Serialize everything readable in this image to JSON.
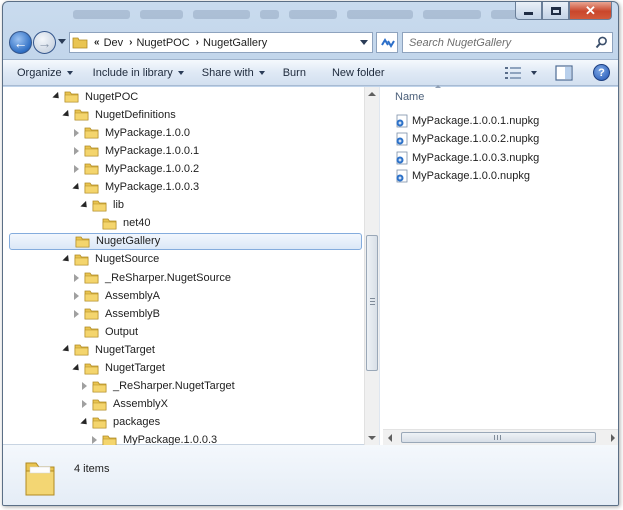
{
  "window": {
    "title_bar": {
      "minimize": "minimize",
      "maximize": "maximize",
      "close": "close"
    }
  },
  "nav": {
    "breadcrumb_prefix": "«",
    "breadcrumbs": [
      "Dev",
      "NugetPOC",
      "NugetGallery"
    ],
    "search_placeholder": "Search NugetGallery"
  },
  "toolbar": {
    "organize": "Organize",
    "include_in_library": "Include in library",
    "share_with": "Share with",
    "burn": "Burn",
    "new_folder": "New folder",
    "help": "?"
  },
  "tree": {
    "items": [
      {
        "label": "NugetPOC",
        "level": 0,
        "state": "expanded"
      },
      {
        "label": "NugetDefinitions",
        "level": 1,
        "state": "expanded"
      },
      {
        "label": "MyPackage.1.0.0",
        "level": 2,
        "state": "collapsed"
      },
      {
        "label": "MyPackage.1.0.0.1",
        "level": 2,
        "state": "collapsed"
      },
      {
        "label": "MyPackage.1.0.0.2",
        "level": 2,
        "state": "collapsed"
      },
      {
        "label": "MyPackage.1.0.0.3",
        "level": 2,
        "state": "expanded"
      },
      {
        "label": "lib",
        "level": 3,
        "state": "expanded"
      },
      {
        "label": "net40",
        "level": 4,
        "state": "none"
      },
      {
        "label": "NugetGallery",
        "level": 1,
        "state": "none",
        "selected": true
      },
      {
        "label": "NugetSource",
        "level": 1,
        "state": "expanded"
      },
      {
        "label": "_ReSharper.NugetSource",
        "level": 2,
        "state": "collapsed"
      },
      {
        "label": "AssemblyA",
        "level": 2,
        "state": "collapsed"
      },
      {
        "label": "AssemblyB",
        "level": 2,
        "state": "collapsed"
      },
      {
        "label": "Output",
        "level": 2,
        "state": "none"
      },
      {
        "label": "NugetTarget",
        "level": 1,
        "state": "expanded"
      },
      {
        "label": "NugetTarget",
        "level": 2,
        "state": "expanded"
      },
      {
        "label": "_ReSharper.NugetTarget",
        "level": 3,
        "state": "collapsed"
      },
      {
        "label": "AssemblyX",
        "level": 3,
        "state": "collapsed"
      },
      {
        "label": "packages",
        "level": 3,
        "state": "expanded"
      },
      {
        "label": "MyPackage.1.0.0.3",
        "level": 4,
        "state": "collapsed"
      }
    ]
  },
  "files": {
    "column_header": "Name",
    "items": [
      "MyPackage.1.0.0.1.nupkg",
      "MyPackage.1.0.0.2.nupkg",
      "MyPackage.1.0.0.3.nupkg",
      "MyPackage.1.0.0.nupkg"
    ]
  },
  "details": {
    "item_count": "4 items"
  },
  "colors": {
    "folder": "#e9c451",
    "selection_border": "#84acdd",
    "chrome": "#b7cde6"
  }
}
